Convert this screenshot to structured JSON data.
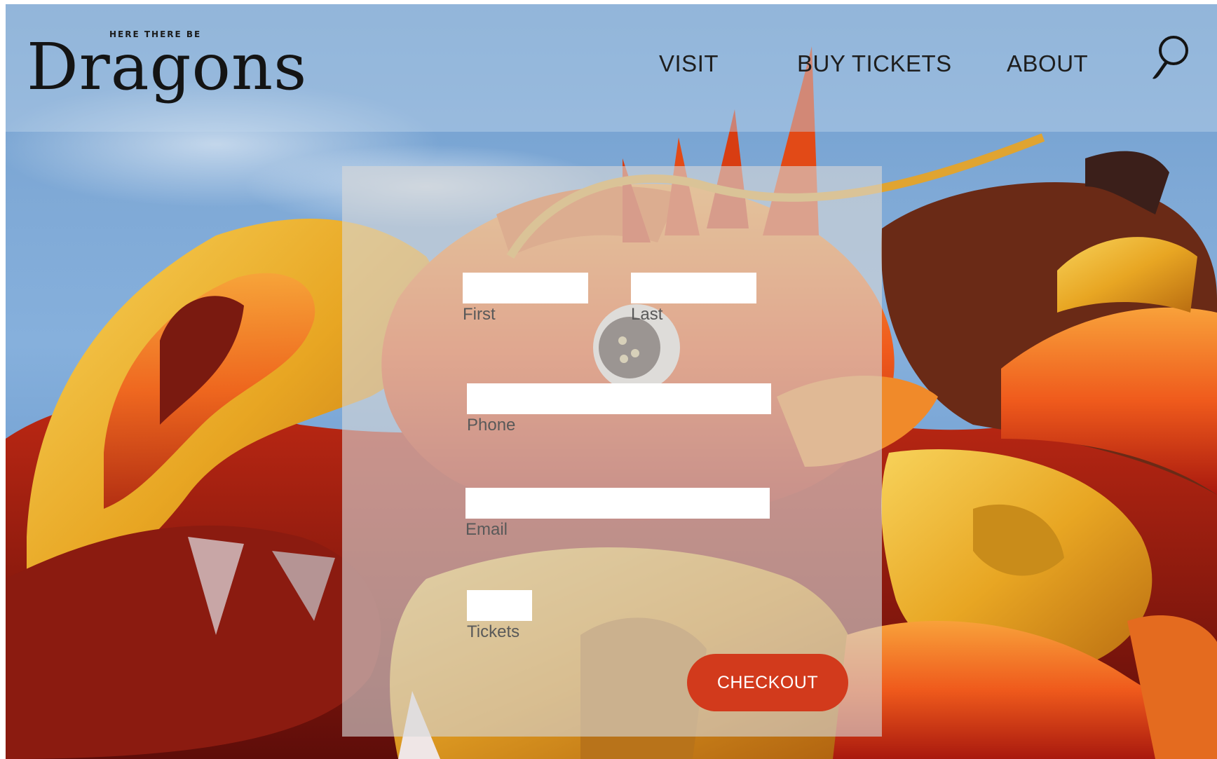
{
  "logo": {
    "tagline": "HERE THERE BE",
    "wordmark": "Dragons"
  },
  "nav": {
    "items": [
      {
        "label": "VISIT"
      },
      {
        "label": "BUY TICKETS"
      },
      {
        "label": "ABOUT"
      }
    ],
    "search_icon": "search-icon"
  },
  "form": {
    "first": {
      "label": "First",
      "value": ""
    },
    "last": {
      "label": "Last",
      "value": ""
    },
    "phone": {
      "label": "Phone",
      "value": ""
    },
    "email": {
      "label": "Email",
      "value": ""
    },
    "tickets": {
      "label": "Tickets",
      "value": ""
    },
    "checkout_label": "CHECKOUT"
  },
  "colors": {
    "accent": "#d23a1c",
    "sky": "#7fa9d6",
    "panel": "#d6d6d6"
  }
}
